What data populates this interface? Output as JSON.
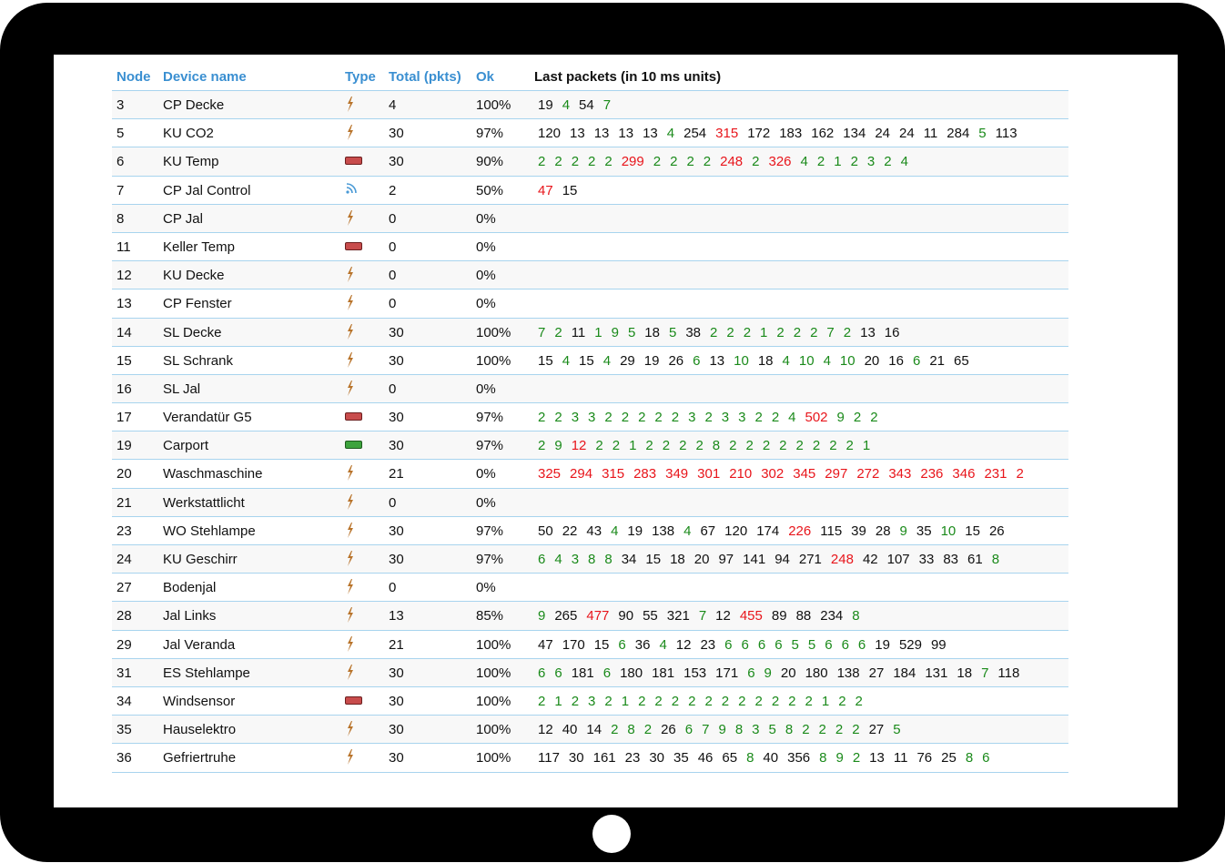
{
  "header": {
    "node": "Node",
    "device_name": "Device name",
    "type": "Type",
    "total": "Total (pkts)",
    "ok": "Ok",
    "last_packets": "Last packets (in 10 ms units)"
  },
  "colors": {
    "header_blue": "#3a8fd1",
    "good": "#1a8a1a",
    "bad": "#e8151b",
    "divider": "#a8d4ee"
  },
  "rows": [
    {
      "node": "3",
      "name": "CP Decke",
      "type": "bolt-icon",
      "total": "4",
      "ok": "100%",
      "packets": [
        [
          "19",
          "k"
        ],
        [
          "4",
          "g"
        ],
        [
          "54",
          "k"
        ],
        [
          "7",
          "g"
        ]
      ]
    },
    {
      "node": "5",
      "name": "KU CO2",
      "type": "bolt-icon",
      "total": "30",
      "ok": "97%",
      "packets": [
        [
          "120",
          "k"
        ],
        [
          "13",
          "k"
        ],
        [
          "13",
          "k"
        ],
        [
          "13",
          "k"
        ],
        [
          "13",
          "k"
        ],
        [
          "4",
          "g"
        ],
        [
          "254",
          "k"
        ],
        [
          "315",
          "r"
        ],
        [
          "172",
          "k"
        ],
        [
          "183",
          "k"
        ],
        [
          "162",
          "k"
        ],
        [
          "134",
          "k"
        ],
        [
          "24",
          "k"
        ],
        [
          "24",
          "k"
        ],
        [
          "11",
          "k"
        ],
        [
          "284",
          "k"
        ],
        [
          "5",
          "g"
        ],
        [
          "113",
          "k"
        ]
      ]
    },
    {
      "node": "6",
      "name": "KU Temp",
      "type": "battery-red-icon",
      "total": "30",
      "ok": "90%",
      "packets": [
        [
          "2",
          "g"
        ],
        [
          "2",
          "g"
        ],
        [
          "2",
          "g"
        ],
        [
          "2",
          "g"
        ],
        [
          "2",
          "g"
        ],
        [
          "299",
          "r"
        ],
        [
          "2",
          "g"
        ],
        [
          "2",
          "g"
        ],
        [
          "2",
          "g"
        ],
        [
          "2",
          "g"
        ],
        [
          "248",
          "r"
        ],
        [
          "2",
          "g"
        ],
        [
          "326",
          "r"
        ],
        [
          "4",
          "g"
        ],
        [
          "2",
          "g"
        ],
        [
          "1",
          "g"
        ],
        [
          "2",
          "g"
        ],
        [
          "3",
          "g"
        ],
        [
          "2",
          "g"
        ],
        [
          "4",
          "g"
        ]
      ]
    },
    {
      "node": "7",
      "name": "CP Jal Control",
      "type": "signal-icon",
      "total": "2",
      "ok": "50%",
      "packets": [
        [
          "47",
          "r"
        ],
        [
          "15",
          "k"
        ]
      ]
    },
    {
      "node": "8",
      "name": "CP Jal",
      "type": "bolt-icon",
      "total": "0",
      "ok": "0%",
      "packets": []
    },
    {
      "node": "11",
      "name": "Keller Temp",
      "type": "battery-red-icon",
      "total": "0",
      "ok": "0%",
      "packets": []
    },
    {
      "node": "12",
      "name": "KU Decke",
      "type": "bolt-icon",
      "total": "0",
      "ok": "0%",
      "packets": []
    },
    {
      "node": "13",
      "name": "CP Fenster",
      "type": "bolt-icon",
      "total": "0",
      "ok": "0%",
      "packets": []
    },
    {
      "node": "14",
      "name": "SL Decke",
      "type": "bolt-icon",
      "total": "30",
      "ok": "100%",
      "packets": [
        [
          "7",
          "g"
        ],
        [
          "2",
          "g"
        ],
        [
          "11",
          "k"
        ],
        [
          "1",
          "g"
        ],
        [
          "9",
          "g"
        ],
        [
          "5",
          "g"
        ],
        [
          "18",
          "k"
        ],
        [
          "5",
          "g"
        ],
        [
          "38",
          "k"
        ],
        [
          "2",
          "g"
        ],
        [
          "2",
          "g"
        ],
        [
          "2",
          "g"
        ],
        [
          "1",
          "g"
        ],
        [
          "2",
          "g"
        ],
        [
          "2",
          "g"
        ],
        [
          "2",
          "g"
        ],
        [
          "7",
          "g"
        ],
        [
          "2",
          "g"
        ],
        [
          "13",
          "k"
        ],
        [
          "16",
          "k"
        ]
      ]
    },
    {
      "node": "15",
      "name": "SL Schrank",
      "type": "bolt-icon",
      "total": "30",
      "ok": "100%",
      "packets": [
        [
          "15",
          "k"
        ],
        [
          "4",
          "g"
        ],
        [
          "15",
          "k"
        ],
        [
          "4",
          "g"
        ],
        [
          "29",
          "k"
        ],
        [
          "19",
          "k"
        ],
        [
          "26",
          "k"
        ],
        [
          "6",
          "g"
        ],
        [
          "13",
          "k"
        ],
        [
          "10",
          "g"
        ],
        [
          "18",
          "k"
        ],
        [
          "4",
          "g"
        ],
        [
          "10",
          "g"
        ],
        [
          "4",
          "g"
        ],
        [
          "10",
          "g"
        ],
        [
          "20",
          "k"
        ],
        [
          "16",
          "k"
        ],
        [
          "6",
          "g"
        ],
        [
          "21",
          "k"
        ],
        [
          "65",
          "k"
        ]
      ]
    },
    {
      "node": "16",
      "name": "SL Jal",
      "type": "bolt-icon",
      "total": "0",
      "ok": "0%",
      "packets": []
    },
    {
      "node": "17",
      "name": "Verandatür G5",
      "type": "battery-red-icon",
      "total": "30",
      "ok": "97%",
      "packets": [
        [
          "2",
          "g"
        ],
        [
          "2",
          "g"
        ],
        [
          "3",
          "g"
        ],
        [
          "3",
          "g"
        ],
        [
          "2",
          "g"
        ],
        [
          "2",
          "g"
        ],
        [
          "2",
          "g"
        ],
        [
          "2",
          "g"
        ],
        [
          "2",
          "g"
        ],
        [
          "3",
          "g"
        ],
        [
          "2",
          "g"
        ],
        [
          "3",
          "g"
        ],
        [
          "3",
          "g"
        ],
        [
          "2",
          "g"
        ],
        [
          "2",
          "g"
        ],
        [
          "4",
          "g"
        ],
        [
          "502",
          "r"
        ],
        [
          "9",
          "g"
        ],
        [
          "2",
          "g"
        ],
        [
          "2",
          "g"
        ]
      ]
    },
    {
      "node": "19",
      "name": "Carport",
      "type": "battery-green-icon",
      "total": "30",
      "ok": "97%",
      "packets": [
        [
          "2",
          "g"
        ],
        [
          "9",
          "g"
        ],
        [
          "12",
          "r"
        ],
        [
          "2",
          "g"
        ],
        [
          "2",
          "g"
        ],
        [
          "1",
          "g"
        ],
        [
          "2",
          "g"
        ],
        [
          "2",
          "g"
        ],
        [
          "2",
          "g"
        ],
        [
          "2",
          "g"
        ],
        [
          "8",
          "g"
        ],
        [
          "2",
          "g"
        ],
        [
          "2",
          "g"
        ],
        [
          "2",
          "g"
        ],
        [
          "2",
          "g"
        ],
        [
          "2",
          "g"
        ],
        [
          "2",
          "g"
        ],
        [
          "2",
          "g"
        ],
        [
          "2",
          "g"
        ],
        [
          "1",
          "g"
        ]
      ]
    },
    {
      "node": "20",
      "name": "Waschmaschine",
      "type": "bolt-icon",
      "total": "21",
      "ok": "0%",
      "packets": [
        [
          "325",
          "r"
        ],
        [
          "294",
          "r"
        ],
        [
          "315",
          "r"
        ],
        [
          "283",
          "r"
        ],
        [
          "349",
          "r"
        ],
        [
          "301",
          "r"
        ],
        [
          "210",
          "r"
        ],
        [
          "302",
          "r"
        ],
        [
          "345",
          "r"
        ],
        [
          "297",
          "r"
        ],
        [
          "272",
          "r"
        ],
        [
          "343",
          "r"
        ],
        [
          "236",
          "r"
        ],
        [
          "346",
          "r"
        ],
        [
          "231",
          "r"
        ],
        [
          "2",
          "r"
        ]
      ]
    },
    {
      "node": "21",
      "name": "Werkstattlicht",
      "type": "bolt-icon",
      "total": "0",
      "ok": "0%",
      "packets": []
    },
    {
      "node": "23",
      "name": "WO Stehlampe",
      "type": "bolt-icon",
      "total": "30",
      "ok": "97%",
      "packets": [
        [
          "50",
          "k"
        ],
        [
          "22",
          "k"
        ],
        [
          "43",
          "k"
        ],
        [
          "4",
          "g"
        ],
        [
          "19",
          "k"
        ],
        [
          "138",
          "k"
        ],
        [
          "4",
          "g"
        ],
        [
          "67",
          "k"
        ],
        [
          "120",
          "k"
        ],
        [
          "174",
          "k"
        ],
        [
          "226",
          "r"
        ],
        [
          "115",
          "k"
        ],
        [
          "39",
          "k"
        ],
        [
          "28",
          "k"
        ],
        [
          "9",
          "g"
        ],
        [
          "35",
          "k"
        ],
        [
          "10",
          "g"
        ],
        [
          "15",
          "k"
        ],
        [
          "26",
          "k"
        ]
      ]
    },
    {
      "node": "24",
      "name": "KU Geschirr",
      "type": "bolt-icon",
      "total": "30",
      "ok": "97%",
      "packets": [
        [
          "6",
          "g"
        ],
        [
          "4",
          "g"
        ],
        [
          "3",
          "g"
        ],
        [
          "8",
          "g"
        ],
        [
          "8",
          "g"
        ],
        [
          "34",
          "k"
        ],
        [
          "15",
          "k"
        ],
        [
          "18",
          "k"
        ],
        [
          "20",
          "k"
        ],
        [
          "97",
          "k"
        ],
        [
          "141",
          "k"
        ],
        [
          "94",
          "k"
        ],
        [
          "271",
          "k"
        ],
        [
          "248",
          "r"
        ],
        [
          "42",
          "k"
        ],
        [
          "107",
          "k"
        ],
        [
          "33",
          "k"
        ],
        [
          "83",
          "k"
        ],
        [
          "61",
          "k"
        ],
        [
          "8",
          "g"
        ]
      ]
    },
    {
      "node": "27",
      "name": "Bodenjal",
      "type": "bolt-icon",
      "total": "0",
      "ok": "0%",
      "packets": []
    },
    {
      "node": "28",
      "name": "Jal Links",
      "type": "bolt-icon",
      "total": "13",
      "ok": "85%",
      "packets": [
        [
          "9",
          "g"
        ],
        [
          "265",
          "k"
        ],
        [
          "477",
          "r"
        ],
        [
          "90",
          "k"
        ],
        [
          "55",
          "k"
        ],
        [
          "321",
          "k"
        ],
        [
          "7",
          "g"
        ],
        [
          "12",
          "k"
        ],
        [
          "455",
          "r"
        ],
        [
          "89",
          "k"
        ],
        [
          "88",
          "k"
        ],
        [
          "234",
          "k"
        ],
        [
          "8",
          "g"
        ]
      ]
    },
    {
      "node": "29",
      "name": "Jal Veranda",
      "type": "bolt-icon",
      "total": "21",
      "ok": "100%",
      "packets": [
        [
          "47",
          "k"
        ],
        [
          "170",
          "k"
        ],
        [
          "15",
          "k"
        ],
        [
          "6",
          "g"
        ],
        [
          "36",
          "k"
        ],
        [
          "4",
          "g"
        ],
        [
          "12",
          "k"
        ],
        [
          "23",
          "k"
        ],
        [
          "6",
          "g"
        ],
        [
          "6",
          "g"
        ],
        [
          "6",
          "g"
        ],
        [
          "6",
          "g"
        ],
        [
          "5",
          "g"
        ],
        [
          "5",
          "g"
        ],
        [
          "6",
          "g"
        ],
        [
          "6",
          "g"
        ],
        [
          "6",
          "g"
        ],
        [
          "19",
          "k"
        ],
        [
          "529",
          "k"
        ],
        [
          "99",
          "k"
        ]
      ]
    },
    {
      "node": "31",
      "name": "ES Stehlampe",
      "type": "bolt-icon",
      "total": "30",
      "ok": "100%",
      "packets": [
        [
          "6",
          "g"
        ],
        [
          "6",
          "g"
        ],
        [
          "181",
          "k"
        ],
        [
          "6",
          "g"
        ],
        [
          "180",
          "k"
        ],
        [
          "181",
          "k"
        ],
        [
          "153",
          "k"
        ],
        [
          "171",
          "k"
        ],
        [
          "6",
          "g"
        ],
        [
          "9",
          "g"
        ],
        [
          "20",
          "k"
        ],
        [
          "180",
          "k"
        ],
        [
          "138",
          "k"
        ],
        [
          "27",
          "k"
        ],
        [
          "184",
          "k"
        ],
        [
          "131",
          "k"
        ],
        [
          "18",
          "k"
        ],
        [
          "7",
          "g"
        ],
        [
          "118",
          "k"
        ]
      ]
    },
    {
      "node": "34",
      "name": "Windsensor",
      "type": "battery-red-icon",
      "total": "30",
      "ok": "100%",
      "packets": [
        [
          "2",
          "g"
        ],
        [
          "1",
          "g"
        ],
        [
          "2",
          "g"
        ],
        [
          "3",
          "g"
        ],
        [
          "2",
          "g"
        ],
        [
          "1",
          "g"
        ],
        [
          "2",
          "g"
        ],
        [
          "2",
          "g"
        ],
        [
          "2",
          "g"
        ],
        [
          "2",
          "g"
        ],
        [
          "2",
          "g"
        ],
        [
          "2",
          "g"
        ],
        [
          "2",
          "g"
        ],
        [
          "2",
          "g"
        ],
        [
          "2",
          "g"
        ],
        [
          "2",
          "g"
        ],
        [
          "2",
          "g"
        ],
        [
          "1",
          "g"
        ],
        [
          "2",
          "g"
        ],
        [
          "2",
          "g"
        ]
      ]
    },
    {
      "node": "35",
      "name": "Hauselektro",
      "type": "bolt-icon",
      "total": "30",
      "ok": "100%",
      "packets": [
        [
          "12",
          "k"
        ],
        [
          "40",
          "k"
        ],
        [
          "14",
          "k"
        ],
        [
          "2",
          "g"
        ],
        [
          "8",
          "g"
        ],
        [
          "2",
          "g"
        ],
        [
          "26",
          "k"
        ],
        [
          "6",
          "g"
        ],
        [
          "7",
          "g"
        ],
        [
          "9",
          "g"
        ],
        [
          "8",
          "g"
        ],
        [
          "3",
          "g"
        ],
        [
          "5",
          "g"
        ],
        [
          "8",
          "g"
        ],
        [
          "2",
          "g"
        ],
        [
          "2",
          "g"
        ],
        [
          "2",
          "g"
        ],
        [
          "2",
          "g"
        ],
        [
          "27",
          "k"
        ],
        [
          "5",
          "g"
        ]
      ]
    },
    {
      "node": "36",
      "name": "Gefriertruhe",
      "type": "bolt-icon",
      "total": "30",
      "ok": "100%",
      "packets": [
        [
          "117",
          "k"
        ],
        [
          "30",
          "k"
        ],
        [
          "161",
          "k"
        ],
        [
          "23",
          "k"
        ],
        [
          "30",
          "k"
        ],
        [
          "35",
          "k"
        ],
        [
          "46",
          "k"
        ],
        [
          "65",
          "k"
        ],
        [
          "8",
          "g"
        ],
        [
          "40",
          "k"
        ],
        [
          "356",
          "k"
        ],
        [
          "8",
          "g"
        ],
        [
          "9",
          "g"
        ],
        [
          "2",
          "g"
        ],
        [
          "13",
          "k"
        ],
        [
          "11",
          "k"
        ],
        [
          "76",
          "k"
        ],
        [
          "25",
          "k"
        ],
        [
          "8",
          "g"
        ],
        [
          "6",
          "g"
        ]
      ]
    }
  ]
}
